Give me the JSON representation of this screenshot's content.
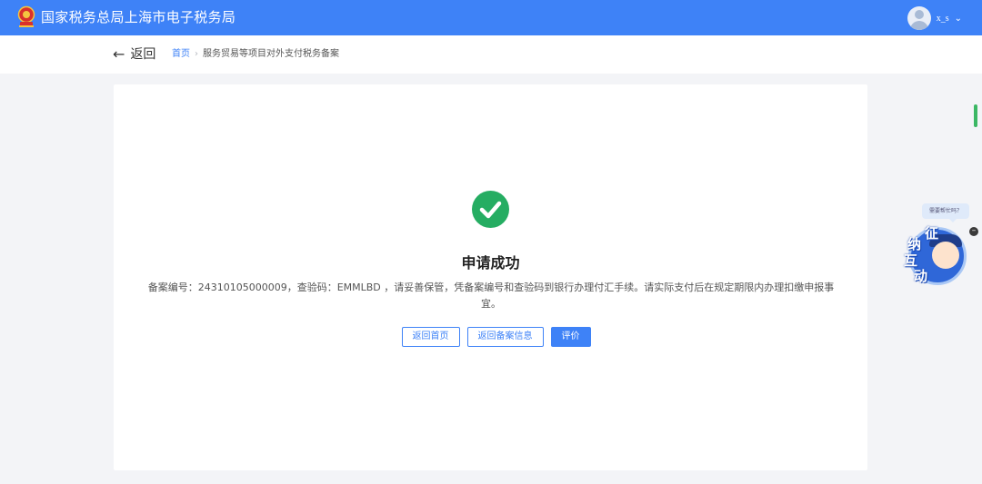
{
  "header": {
    "title": "国家税务总局上海市电子税务局",
    "username": "x_s",
    "emblem_icon": "national-tax-emblem",
    "colors": {
      "bar": "#3e82f7"
    }
  },
  "breadcrumb": {
    "back_label": "返回",
    "home": "首页",
    "current": "服务贸易等项目对外支付税务备案"
  },
  "result": {
    "title": "申请成功",
    "message": "备案编号：24310105000009，查验码：EMMLBD ，请妥善保管，凭备案编号和查验码到银行办理付汇手续。请实际支付后在规定期限内办理扣缴申报事宜。",
    "status_color": "#25ad62"
  },
  "actions": {
    "home_button": "返回首页",
    "record_button": "返回备案信息",
    "rate_button": "评价"
  },
  "assistant": {
    "bubble_text": "需要帮忙吗？",
    "chars": [
      "征",
      "纳",
      "互",
      "动"
    ]
  }
}
